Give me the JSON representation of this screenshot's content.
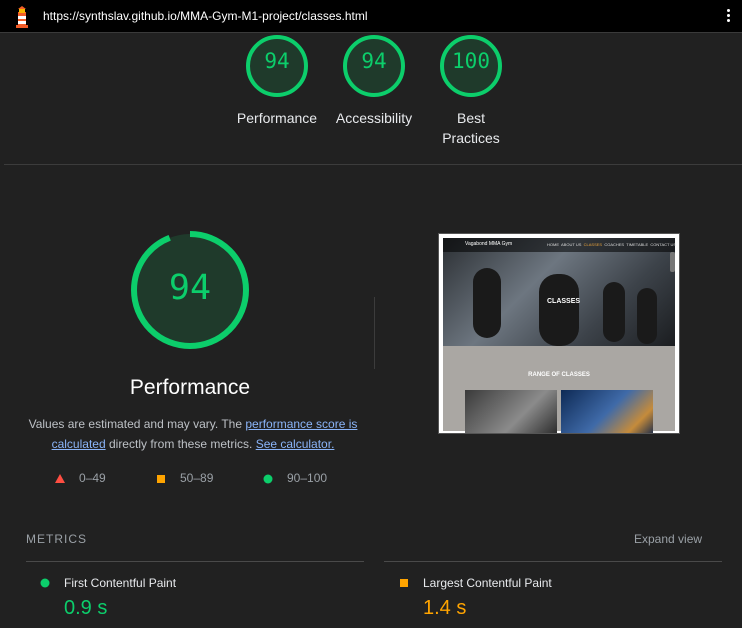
{
  "browser": {
    "url": "https://synthslav.github.io/MMA-Gym-M1-project/classes.html",
    "logo_icon": "lighthouse-icon",
    "menu_icon": "vertical-ellipsis-icon"
  },
  "summary_scores": [
    {
      "score": "94",
      "label": "Performance"
    },
    {
      "score": "94",
      "label": "Accessibility"
    },
    {
      "score": "100",
      "label": "Best Practices"
    }
  ],
  "performance": {
    "score": "94",
    "score_fraction": 0.94,
    "title": "Performance",
    "desc_prefix": "Values are estimated and may vary. The ",
    "link1": "performance score is calculated",
    "desc_middle": " directly from these metrics. ",
    "link2": "See calculator."
  },
  "legend": [
    {
      "range": "0–49",
      "shape": "triangle",
      "color": "#ff4e42"
    },
    {
      "range": "50–89",
      "shape": "square",
      "color": "#ffa400"
    },
    {
      "range": "90–100",
      "shape": "circle",
      "color": "#0cce6b"
    }
  ],
  "screenshot": {
    "brand": "Vagabond MMA Gym",
    "nav_links": [
      "HOME",
      "ABOUT US",
      "CLASSES",
      "COACHES",
      "TIMETABLE",
      "CONTACT US"
    ],
    "hero_title": "CLASSES",
    "section_title": "RANGE OF CLASSES"
  },
  "metrics": {
    "heading": "METRICS",
    "expand": "Expand view",
    "items": [
      {
        "name": "First Contentful Paint",
        "value": "0.9 s",
        "status": "good",
        "color": "#0cce6b"
      },
      {
        "name": "Largest Contentful Paint",
        "value": "1.4 s",
        "status": "average",
        "color": "#ffa400"
      }
    ]
  },
  "colors": {
    "good": "#0cce6b",
    "average": "#ffa400",
    "fail": "#ff4e42",
    "background": "#212121"
  }
}
